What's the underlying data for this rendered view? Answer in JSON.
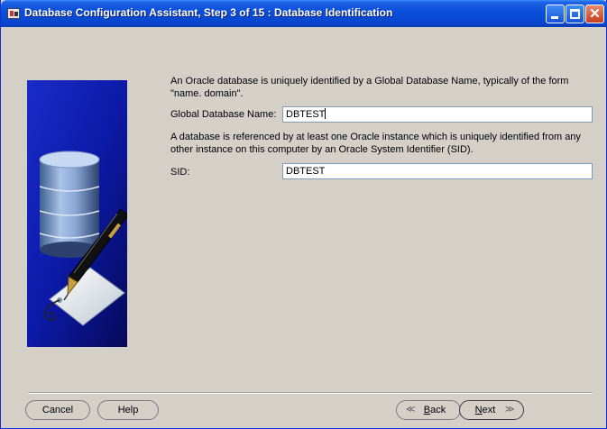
{
  "window": {
    "title": "Database Configuration Assistant, Step 3 of 15 : Database Identification",
    "controls": {
      "minimize": "minimize",
      "maximize": "maximize",
      "close": "✕"
    }
  },
  "main": {
    "description_1": "An Oracle database is uniquely identified by a Global Database Name, typically of the form \"name. domain\".",
    "global_db_name_label": "Global Database Name:",
    "global_db_name_value": "DBTEST",
    "description_2": "A database is referenced by at least one Oracle instance which is uniquely identified from any other instance on this computer by an Oracle System Identifier (SID).",
    "sid_label": "SID:",
    "sid_value": "DBTEST"
  },
  "buttons": {
    "cancel": "Cancel",
    "help": "Help",
    "back_arrow": "≪",
    "back_mnemonic": "B",
    "back_rest": "ack",
    "next_mnemonic": "N",
    "next_rest": "ext",
    "next_arrow": "≫"
  },
  "colors": {
    "titlebar": "#0a4fd8",
    "dialog_bg": "#d4d0c8",
    "illustration_bg": "#0c1aa8"
  },
  "icons": [
    "database-cylinder-icon",
    "pen-icon",
    "tag-icon"
  ]
}
